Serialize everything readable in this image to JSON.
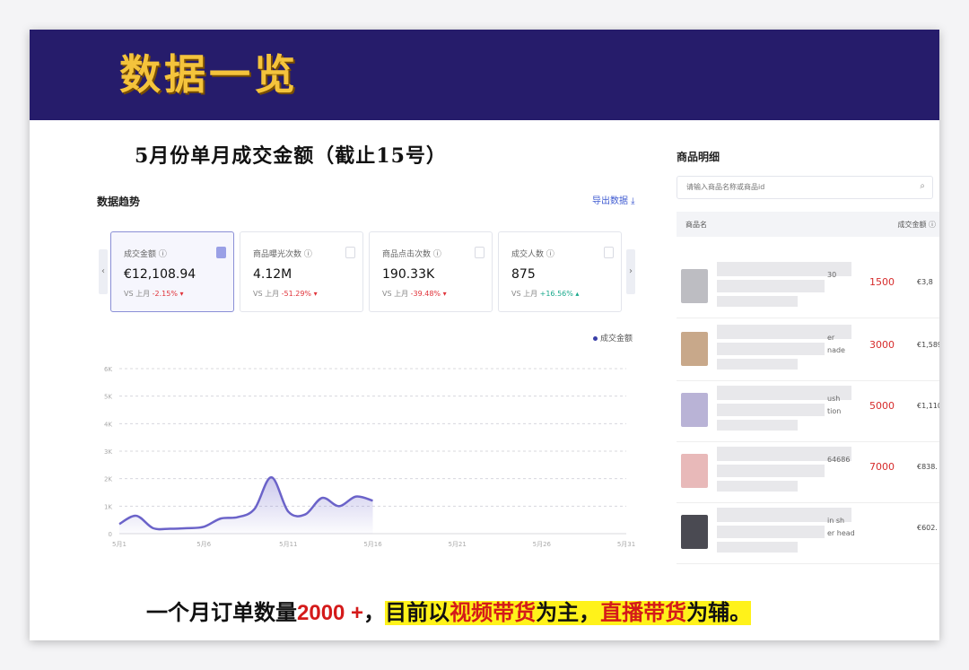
{
  "banner": {
    "title": "数据一览"
  },
  "subheading": "5月份单月成交金额（截止15号）",
  "trend": {
    "title": "数据趋势",
    "export_label": "导出数据 ⤓",
    "kpis": [
      {
        "label": "成交金额 ⓘ",
        "value": "€12,108.94",
        "cmp_prefix": "VS 上月 ",
        "cmp_value": "-2.15% ▾",
        "direction": "down",
        "active": true
      },
      {
        "label": "商品曝光次数 ⓘ",
        "value": "4.12M",
        "cmp_prefix": "VS 上月 ",
        "cmp_value": "-51.29% ▾",
        "direction": "down",
        "active": false
      },
      {
        "label": "商品点击次数 ⓘ",
        "value": "190.33K",
        "cmp_prefix": "VS 上月 ",
        "cmp_value": "-39.48% ▾",
        "direction": "down",
        "active": false
      },
      {
        "label": "成交人数 ⓘ",
        "value": "875",
        "cmp_prefix": "VS 上月 ",
        "cmp_value": "+16.56% ▴",
        "direction": "up",
        "active": false
      }
    ],
    "arrow_left": "‹",
    "arrow_right": "›",
    "legend_label": "成交金额"
  },
  "chart_data": {
    "type": "area",
    "x_tick_labels": [
      "5月1",
      "5月6",
      "5月11",
      "5月16",
      "5月21",
      "5月26",
      "5月31"
    ],
    "y_tick_labels": [
      "0",
      "1K",
      "2K",
      "3K",
      "4K",
      "5K",
      "6K"
    ],
    "ylim": [
      0,
      6000
    ],
    "xlim": [
      1,
      31
    ],
    "grid": true,
    "legend_position": "top-right",
    "series": [
      {
        "name": "成交金额",
        "color": "#6b63c9",
        "x": [
          1,
          2,
          3,
          4,
          5,
          6,
          7,
          8,
          9,
          10,
          11,
          12,
          13,
          14,
          15,
          16
        ],
        "values": [
          350,
          650,
          200,
          180,
          200,
          250,
          550,
          600,
          900,
          2050,
          800,
          700,
          1300,
          1000,
          1350,
          1200
        ]
      }
    ]
  },
  "products": {
    "title": "商品明细",
    "search_placeholder": "请输入商品名称或商品id",
    "header_name": "商品名",
    "header_amount": "成交金额 ⓘ",
    "rows": [
      {
        "qty": "1500",
        "amount": "€3,8",
        "frag1": "30",
        "frag2": "",
        "thumb_color": "#bdbdc2"
      },
      {
        "qty": "3000",
        "amount": "€1,589.",
        "frag1": "er",
        "frag2": "nade",
        "thumb_color": "#c8a88a"
      },
      {
        "qty": "5000",
        "amount": "€1,110.",
        "frag1": "ush",
        "frag2": "tion",
        "thumb_color": "#b9b3d6"
      },
      {
        "qty": "7000",
        "amount": "€838.",
        "frag1": "64686",
        "frag2": "",
        "thumb_color": "#e8b9b9"
      },
      {
        "qty": "",
        "amount": "€602.",
        "frag1": "in sh",
        "frag2": "er head",
        "thumb_color": "#4a4a52"
      }
    ]
  },
  "bottom_line": {
    "part1": "一个月订单数量",
    "part2": "2000 +",
    "part3": "，",
    "part4": "目前以",
    "part5": "视频带货",
    "part6": "为主，",
    "part7": "直播带货",
    "part8": "为辅。"
  }
}
